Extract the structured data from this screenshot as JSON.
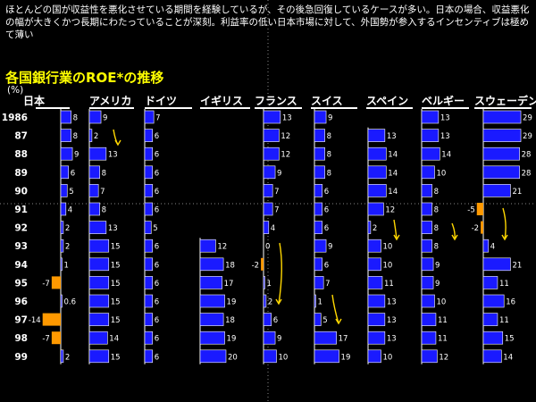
{
  "intro": "ほとんどの国が収益性を悪化させている期間を経験しているが、その後急回復しているケースが多い。日本の場合、収益悪化の幅が大きくかつ長期にわたっていることが深刻。利益率の低い日本市場に対して、外国勢が参入するインセンティブは極めて薄い",
  "chart_title": "各国銀行業のROE*の推移",
  "unit": "(%)",
  "colors": {
    "positive": "#1a1aff",
    "negative": "#ff9900",
    "title": "#ffff00",
    "arrow": "#ffd700"
  },
  "chart_data": {
    "type": "bar",
    "orientation": "horizontal",
    "title": "各国銀行業のROE*の推移",
    "ylabel": "(%)",
    "categories": [
      "1986",
      "87",
      "88",
      "89",
      "90",
      "91",
      "92",
      "93",
      "94",
      "95",
      "96",
      "97",
      "98",
      "99"
    ],
    "series": [
      {
        "name": "日本",
        "values": [
          8,
          8,
          9,
          6,
          5,
          4,
          2,
          2,
          1,
          -7,
          0.6,
          -14,
          -7,
          2
        ]
      },
      {
        "name": "アメリカ",
        "values": [
          9,
          2,
          13,
          8,
          7,
          8,
          13,
          15,
          15,
          15,
          15,
          15,
          14,
          15
        ]
      },
      {
        "name": "ドイツ",
        "values": [
          7,
          6,
          6,
          6,
          6,
          6,
          5,
          6,
          6,
          6,
          6,
          6,
          6,
          6
        ]
      },
      {
        "name": "イギリス",
        "values": [
          null,
          null,
          null,
          null,
          null,
          null,
          null,
          12,
          18,
          17,
          19,
          18,
          19,
          20
        ]
      },
      {
        "name": "フランス",
        "values": [
          13,
          12,
          12,
          9,
          7,
          7,
          4,
          0,
          -2,
          1,
          2,
          6,
          9,
          10
        ]
      },
      {
        "name": "スイス",
        "values": [
          9,
          8,
          8,
          8,
          6,
          6,
          6,
          9,
          6,
          7,
          1,
          5,
          17,
          19
        ]
      },
      {
        "name": "スペイン",
        "values": [
          null,
          13,
          14,
          14,
          14,
          12,
          2,
          10,
          10,
          11,
          13,
          13,
          13,
          10
        ]
      },
      {
        "name": "ベルギー",
        "values": [
          13,
          13,
          14,
          10,
          8,
          8,
          8,
          8,
          9,
          9,
          10,
          11,
          11,
          12
        ]
      },
      {
        "name": "スウェーデン",
        "values": [
          29,
          29,
          28,
          28,
          21,
          -5,
          -2,
          4,
          21,
          11,
          16,
          11,
          15,
          14
        ]
      }
    ]
  }
}
